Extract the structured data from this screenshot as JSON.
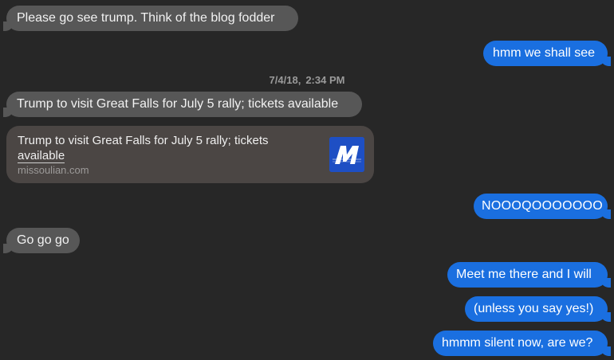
{
  "messages": {
    "m1": "Please go see trump. Think of the blog fodder",
    "m2": "hmm we shall see",
    "m3": "Trump to visit Great Falls for July 5 rally; tickets available",
    "m4": "NOOOQOOOOOOO",
    "m5": "Go go go",
    "m6": "Meet me there and I will",
    "m7": "(unless you say yes!)",
    "m8": "hmmm silent now, are we?"
  },
  "timestamp": {
    "date": "7/4/18,",
    "time": "2:34 PM"
  },
  "link_preview": {
    "title_line1": "Trump to visit Great Falls for July 5 rally; tickets",
    "title_line2": "available",
    "domain": "missoulian.com",
    "logo_letter": "M",
    "logo_color": "#1e4fc4"
  },
  "colors": {
    "background": "#272727",
    "received_bubble": "#575757",
    "sent_bubble": "#1a6fe0",
    "preview_card": "#4b4644"
  }
}
